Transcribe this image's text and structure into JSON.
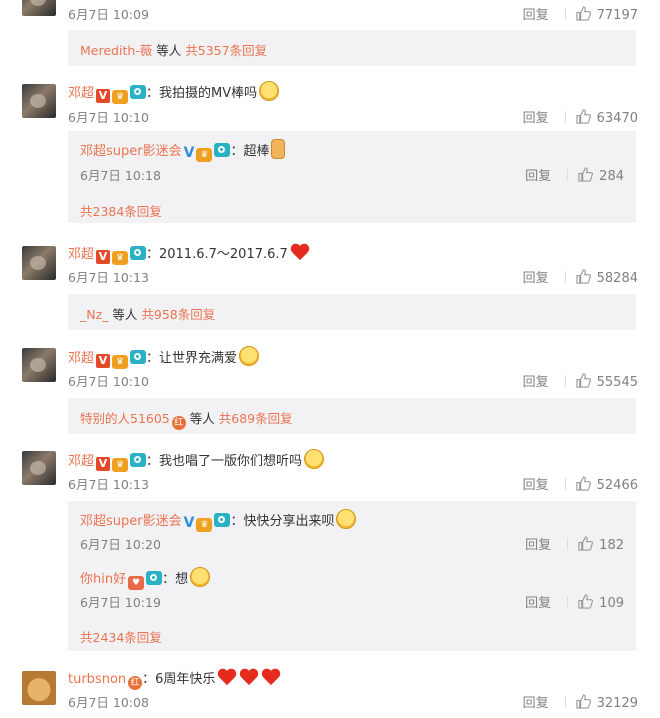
{
  "labels": {
    "reply": "回复"
  },
  "top": {
    "time": "6月7日 10:09",
    "likes": "77197",
    "more": {
      "user": "Meredith-薇",
      "etc": "等人",
      "count": "共5357条回复"
    }
  },
  "c1": {
    "name": "邓超",
    "text": "：我拍摄的MV棒吗",
    "time": "6月7日 10:10",
    "likes": "63470",
    "reply1": {
      "name": "邓超super影迷会",
      "text": "：超棒",
      "time": "6月7日 10:18",
      "likes": "284"
    },
    "more": "共2384条回复"
  },
  "c2": {
    "name": "邓超",
    "text": "：2011.6.7～2017.6.7",
    "time": "6月7日 10:13",
    "likes": "58284",
    "more": {
      "user": "_Nz_",
      "etc": "等人",
      "count": "共958条回复"
    }
  },
  "c3": {
    "name": "邓超",
    "text": "：让世界充满爱",
    "time": "6月7日 10:10",
    "likes": "55545",
    "more": {
      "user": "特别的人51605",
      "etc": "等人",
      "count": "共689条回复"
    }
  },
  "c4": {
    "name": "邓超",
    "text": "：我也唱了一版你们想听吗",
    "time": "6月7日 10:13",
    "likes": "52466",
    "reply1": {
      "name": "邓超super影迷会",
      "text": "：快快分享出来呗",
      "time": "6月7日 10:20",
      "likes": "182"
    },
    "reply2": {
      "name": "你hin好",
      "text": "：想",
      "time": "6月7日 10:19",
      "likes": "109"
    },
    "more": "共2434条回复"
  },
  "c5": {
    "name": "turbsnon",
    "text": "：6周年快乐",
    "time": "6月7日 10:08",
    "likes": "32129"
  },
  "icons": {
    "like": "thumbs-up-icon",
    "emoji": "smile-face-icon",
    "heart": "heart-icon"
  },
  "colors": {
    "name": "#eb7350",
    "meta": "#808080",
    "subbox": "#f2f2f5"
  }
}
